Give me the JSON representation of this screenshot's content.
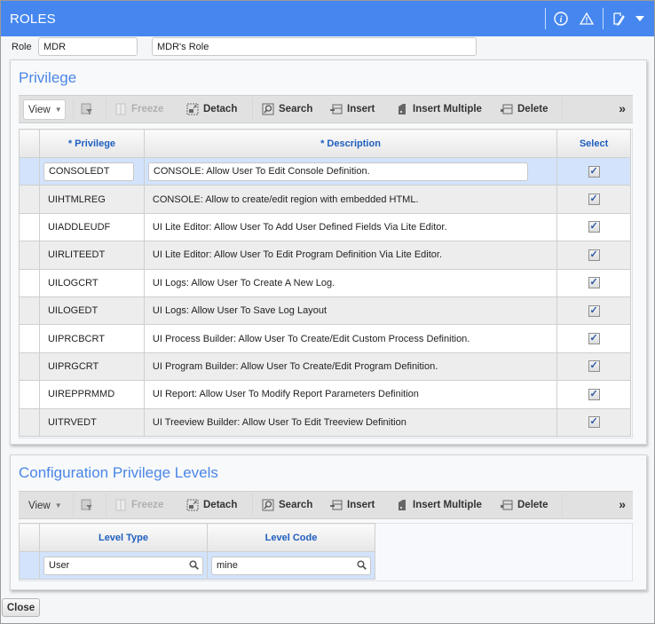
{
  "window": {
    "title": "ROLES",
    "icons": [
      "info-icon",
      "warning-icon",
      "edit-icon",
      "dropdown-caret-icon"
    ]
  },
  "role": {
    "label": "Role",
    "code": "MDR",
    "name": "MDR's Role"
  },
  "toolbar": {
    "view": "View",
    "freeze": "Freeze",
    "detach": "Detach",
    "search": "Search",
    "insert": "Insert",
    "insert_multiple": "Insert Multiple",
    "delete": "Delete",
    "more": "»"
  },
  "privilege_panel": {
    "title": "Privilege",
    "columns": [
      "* Privilege",
      "* Description",
      "Select"
    ],
    "rows": [
      {
        "privilege": "CONSOLEDT",
        "description": "CONSOLE: Allow User To Edit Console Definition.",
        "selected": true
      },
      {
        "privilege": "UIHTMLREG",
        "description": "CONSOLE: Allow to create/edit region with embedded HTML.",
        "selected": true
      },
      {
        "privilege": "UIADDLEUDF",
        "description": "UI Lite Editor: Allow User To Add User Defined Fields Via Lite Editor.",
        "selected": true
      },
      {
        "privilege": "UIRLITEEDT",
        "description": "UI Lite Editor: Allow User To Edit Program Definition Via Lite Editor.",
        "selected": true
      },
      {
        "privilege": "UILOGCRT",
        "description": "UI Logs: Allow User To Create A New Log.",
        "selected": true
      },
      {
        "privilege": "UILOGEDT",
        "description": "UI Logs: Allow User To Save Log Layout",
        "selected": true
      },
      {
        "privilege": "UIPRCBCRT",
        "description": "UI Process Builder: Allow User To Create/Edit Custom Process Definition.",
        "selected": true
      },
      {
        "privilege": "UIPRGCRT",
        "description": "UI Program Builder: Allow User To Create/Edit Program Definition.",
        "selected": true
      },
      {
        "privilege": "UIREPPRMMD",
        "description": "UI Report: Allow User To Modify Report Parameters Definition",
        "selected": true
      },
      {
        "privilege": "UITRVEDT",
        "description": "UI Treeview Builder: Allow User To Edit Treeview Definition",
        "selected": true
      }
    ]
  },
  "config_panel": {
    "title": "Configuration Privilege Levels",
    "columns": [
      "Level Type",
      "Level Code"
    ],
    "rows": [
      {
        "level_type": "User",
        "level_code": "mine"
      }
    ]
  },
  "footer": {
    "close": "Close"
  },
  "colors": {
    "titlebar": "#4687ef",
    "panel_title": "#4a86e8",
    "column_header": "#1f5fbf",
    "selected_row": "#d2e3fb"
  }
}
